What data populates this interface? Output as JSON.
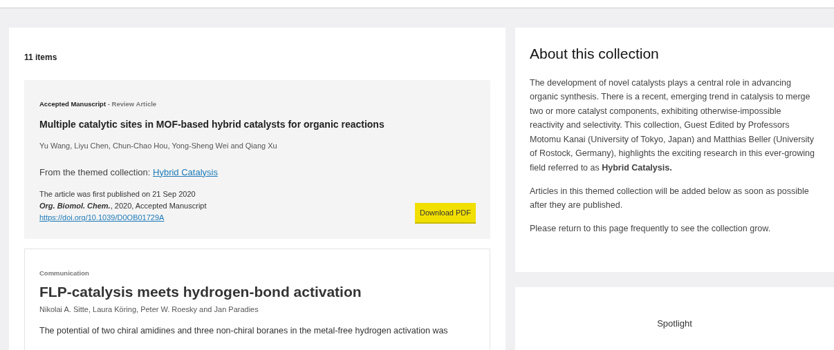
{
  "results": {
    "count": "11 items"
  },
  "articles": [
    {
      "kind": "accepted",
      "status": "Accepted Manuscript",
      "separator": " - ",
      "type": "Review Article",
      "title": "Multiple catalytic sites in MOF-based hybrid catalysts for organic reactions",
      "authors": "Yu Wang, Liyu Chen, Chun-Chao Hou, Yong-Sheng Wei and Qiang Xu",
      "collection_label": "From the themed collection:",
      "collection_link": "Hybrid Catalysis",
      "published": "The article was first published on 21 Sep 2020",
      "citation": "**Org. Biomol. Chem.**, 2020, Accepted Manuscript",
      "doi": "https://doi.org/10.1039/D0OB01729A",
      "button": "Download PDF"
    },
    {
      "kind": "published",
      "type": "Communication",
      "title": "FLP-catalysis meets hydrogen-bond activation",
      "authors": "Nikolai A. Sitte, Laura Köring, Peter W. Roesky and Jan Paradies",
      "abstract": "The potential of two chiral amidines and three non-chiral boranes in the metal-free hydrogen activation was"
    }
  ],
  "about": {
    "title": "About this collection",
    "paragraphs": [
      "The development of novel catalysts plays a central role in advancing organic synthesis. There is a recent, emerging trend in catalysis to merge two or more catalyst components, exhibiting otherwise-impossible reactivity and selectivity. This collection, Guest Edited by Professors Motomu Kanai (University of Tokyo, Japan) and Matthias Beller (University of Rostock, Germany), highlights the exciting research in this ever-growing field referred to as **Hybrid Catalysis.**",
      "Articles in this themed collection will be added below as soon as possible after they are published.",
      "Please return to this page frequently to see the collection grow."
    ]
  },
  "spotlight": {
    "title": "Spotlight"
  }
}
